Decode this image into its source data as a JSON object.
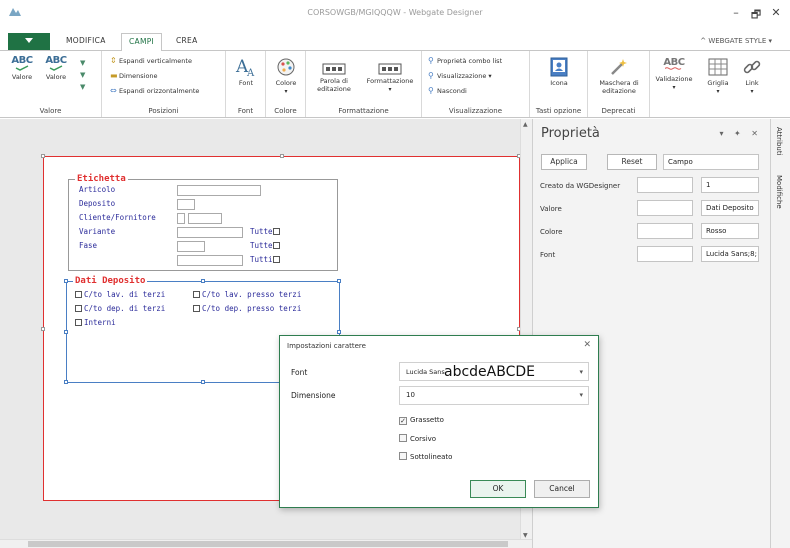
{
  "window": {
    "title": "CORSOWGB/MGIQQQW - Webgate Designer",
    "minimize": "–",
    "restore": "🗗",
    "close": "✕"
  },
  "ribbon_tabs": {
    "file": "",
    "items": [
      "MODIFICA",
      "CAMPI",
      "CREA"
    ],
    "active": "CAMPI",
    "style_menu": "^ WEBGATE STYLE ▾",
    "pin": "✱"
  },
  "ribbon": {
    "valore": {
      "btn1": "Valore",
      "btn2": "Valore",
      "label": "Valore"
    },
    "posizioni": {
      "row1": "Espandi verticalmente",
      "row2": "Dimensione",
      "row3": "Espandi orizzontalmente",
      "label": "Posizioni"
    },
    "font": {
      "btn": "Font",
      "label": "Font"
    },
    "colore": {
      "btn": "Colore",
      "label": "Colore"
    },
    "formattazione": {
      "btn1_line1": "Parola di",
      "btn1_line2": "editazione",
      "btn2": "Formattazione",
      "label": "Formattazione"
    },
    "visualizzazione": {
      "row1": "Proprietà combo list",
      "row2": "Visualizzazione",
      "row3": "Nascondi",
      "label": "Visualizzazione"
    },
    "tasti": {
      "btn": "Icona",
      "label": "Tasti opzione"
    },
    "deprecati": {
      "btn_line1": "Maschera di",
      "btn_line2": "editazione",
      "label": "Deprecati"
    },
    "extra": {
      "validazione": "Validazione",
      "griglia": "Griglia",
      "link": "Link"
    }
  },
  "form": {
    "etichetta": {
      "legend": "Etichetta",
      "fields": [
        "Articolo",
        "Deposito",
        "Cliente/Fornitore",
        "Variante",
        "Fase"
      ],
      "checks": [
        "Tutte",
        "Tutte",
        "Tutti"
      ]
    },
    "dati_deposito": {
      "legend": "Dati Deposito",
      "opt1": "C/to lav. di terzi",
      "opt2": "C/to lav. presso terzi",
      "opt3": "C/to dep. di terzi",
      "opt4": "C/to dep. presso terzi",
      "opt5": "Interni"
    }
  },
  "properties": {
    "title": "Proprietà",
    "tools": "▾ ✦ ✕",
    "buttons": {
      "apply": "Applica",
      "reset": "Reset",
      "field": "Campo"
    },
    "rows": [
      {
        "label": "Creato da WGDesigner",
        "value": "1"
      },
      {
        "label": "Valore",
        "value": "Dati Deposito"
      },
      {
        "label": "Colore",
        "value": "Rosso"
      },
      {
        "label": "Font",
        "value": "Lucida Sans;8;"
      }
    ],
    "side_tabs": [
      "Attributi",
      "Modifiche"
    ]
  },
  "dialog": {
    "title": "Impostazioni carattere",
    "close": "✕",
    "font_label": "Font",
    "font_value": "Lucida Sans",
    "font_preview": "abcdeABCDE",
    "size_label": "Dimensione",
    "size_value": "10",
    "bold": "Grassetto",
    "bold_checked": "✓",
    "italic": "Corsivo",
    "underline": "Sottolineato",
    "ok": "OK",
    "cancel": "Cancel"
  },
  "colors": {
    "accent": "#1f7244",
    "error_red": "#e03030",
    "selection_blue": "#4a7fc4"
  }
}
